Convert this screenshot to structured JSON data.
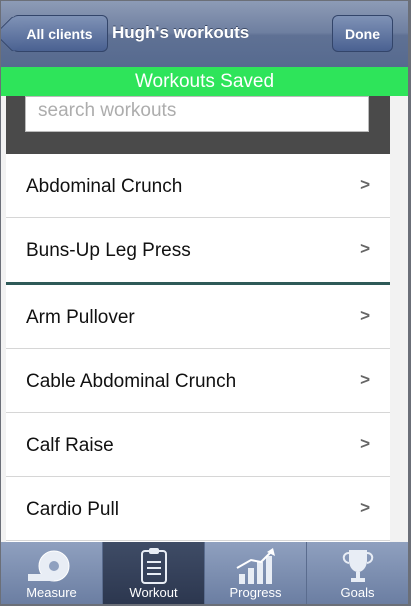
{
  "header": {
    "back_label": "All clients",
    "title": "Hugh's workouts",
    "done_label": "Done"
  },
  "banner": {
    "text": "Workouts Saved",
    "color": "#2ee45a"
  },
  "search": {
    "placeholder": "search workouts",
    "value": ""
  },
  "list": {
    "items": [
      {
        "label": "Abdominal Crunch",
        "chevron": ">"
      },
      {
        "label": "Buns-Up Leg Press",
        "chevron": ">"
      },
      {
        "label": "Arm Pullover",
        "chevron": ">"
      },
      {
        "label": "Cable Abdominal Crunch",
        "chevron": ">"
      },
      {
        "label": "Calf Raise",
        "chevron": ">"
      },
      {
        "label": "Cardio Pull",
        "chevron": ">"
      }
    ]
  },
  "tabs": [
    {
      "label": "Measure",
      "icon": "tape-measure-icon",
      "active": false
    },
    {
      "label": "Workout",
      "icon": "clipboard-icon",
      "active": true
    },
    {
      "label": "Progress",
      "icon": "bar-chart-arrow-icon",
      "active": false
    },
    {
      "label": "Goals",
      "icon": "trophy-icon",
      "active": false
    }
  ],
  "colors": {
    "navbar": "#6e7fa0",
    "divider": "#2e5a58",
    "tab_active": "#3f4c66"
  }
}
